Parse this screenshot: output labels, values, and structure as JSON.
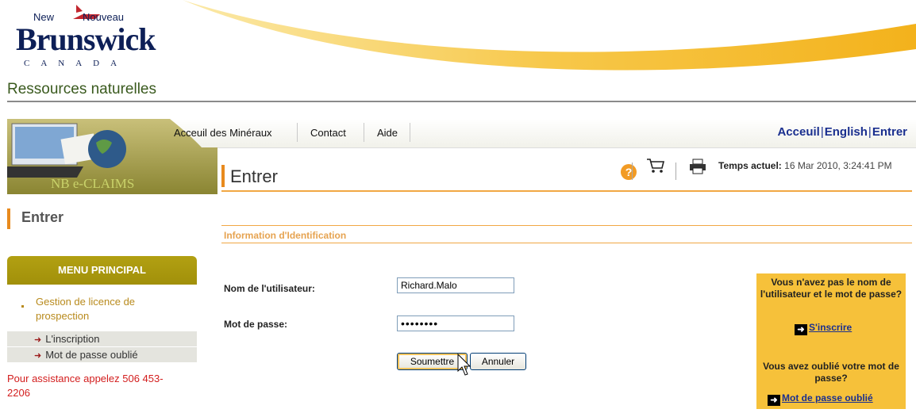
{
  "header": {
    "logo_new": "New",
    "logo_nouveau": "Nouveau",
    "logo_brunswick": "Brunswick",
    "logo_canada": "CANADA",
    "department": "Ressources naturelles"
  },
  "banner": {
    "label": "NB e-CLAIMS"
  },
  "nav": {
    "items": [
      "Acceuil des Minéraux",
      "Contact",
      "Aide"
    ],
    "right": {
      "home": "Acceuil",
      "english": "English",
      "enter": "Entrer"
    }
  },
  "toolbar": {
    "help_icon": "help-icon",
    "cart_icon": "cart-icon",
    "print_icon": "print-icon",
    "time_label": "Temps actuel:",
    "time_value": "16 Mar 2010, 3:24:41 PM"
  },
  "page": {
    "title": "Entrer",
    "side_title": "Entrer"
  },
  "menu": {
    "header": "MENU PRINCIPAL",
    "main_item": "Gestion de licence de prospection",
    "sub_items": [
      "L'inscription",
      "Mot de passe oublié"
    ],
    "assistance": "Pour assistance appelez 506 453-2206"
  },
  "form": {
    "section_title": "Information d'Identification",
    "username_label": "Nom de l'utilisateur:",
    "username_value": "Richard.Malo",
    "password_label": "Mot de passe:",
    "password_value": "••••••••",
    "submit_label": "Soumettre",
    "cancel_label": "Annuler"
  },
  "help_box": {
    "no_account_text": "Vous n'avez pas le nom de l'utilisateur et le mot de passe?",
    "register_link": "S'inscrire",
    "forgot_text": "Vous avez oublié votre mot de passe?",
    "forgot_link": "Mot de passe oublié"
  },
  "colors": {
    "accent_orange": "#e88a1e",
    "menu_olive": "#a1900a",
    "help_box_yellow": "#f6c13a",
    "link_blue": "#1a2f8f",
    "assist_red": "#d31e1e"
  }
}
